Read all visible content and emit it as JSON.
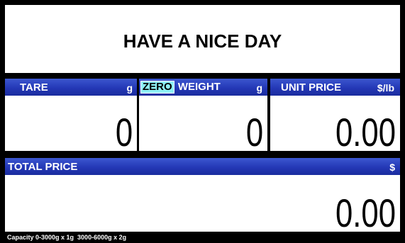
{
  "message": "HAVE A NICE DAY",
  "tare": {
    "label": "TARE",
    "unit": "g",
    "value": "0"
  },
  "weight": {
    "zero_indicator": "ZERO",
    "label": "WEIGHT",
    "unit": "g",
    "value": "0"
  },
  "unit_price": {
    "label": "UNIT PRICE",
    "unit": "$/lb",
    "value": "0.00"
  },
  "total_price": {
    "label": "TOTAL PRICE",
    "unit": "$",
    "value": "0.00"
  },
  "capacity": "Capacity 0-3000g x 1g  3000-6000g x 2g",
  "colors": {
    "header_blue": "#2438b6",
    "zero_badge": "#8ff2f6",
    "frame": "#000000"
  }
}
